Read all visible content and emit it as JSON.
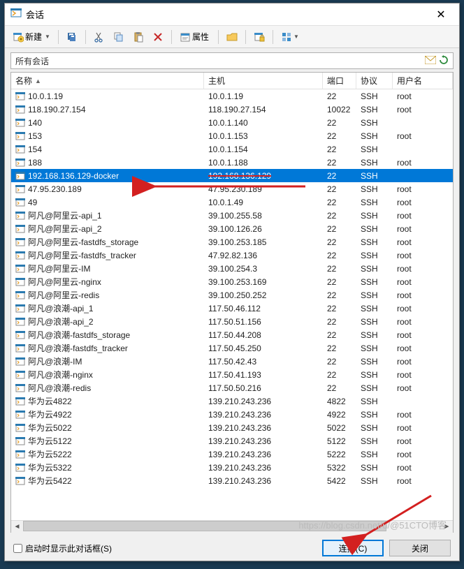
{
  "window": {
    "title": "会话"
  },
  "toolbar": {
    "new_label": "新建",
    "props_label": "属性"
  },
  "filter": {
    "label": "所有会话"
  },
  "columns": {
    "name": "名称",
    "host": "主机",
    "port": "端口",
    "protocol": "协议",
    "user": "用户名"
  },
  "sessions": [
    {
      "name": "10.0.1.19",
      "host": "10.0.1.19",
      "port": "22",
      "proto": "SSH",
      "user": "root"
    },
    {
      "name": "118.190.27.154",
      "host": "118.190.27.154",
      "port": "10022",
      "proto": "SSH",
      "user": "root"
    },
    {
      "name": "140",
      "host": "10.0.1.140",
      "port": "22",
      "proto": "SSH",
      "user": ""
    },
    {
      "name": "153",
      "host": "10.0.1.153",
      "port": "22",
      "proto": "SSH",
      "user": "root"
    },
    {
      "name": "154",
      "host": "10.0.1.154",
      "port": "22",
      "proto": "SSH",
      "user": ""
    },
    {
      "name": "188",
      "host": "10.0.1.188",
      "port": "22",
      "proto": "SSH",
      "user": "root"
    },
    {
      "name": "192.168.136.129-docker",
      "host": "192.168.136.129",
      "port": "22",
      "proto": "SSH",
      "user": "",
      "selected": true
    },
    {
      "name": "47.95.230.189",
      "host": "47.95.230.189",
      "port": "22",
      "proto": "SSH",
      "user": "root"
    },
    {
      "name": "49",
      "host": "10.0.1.49",
      "port": "22",
      "proto": "SSH",
      "user": "root"
    },
    {
      "name": "阿凡@阿里云-api_1",
      "host": "39.100.255.58",
      "port": "22",
      "proto": "SSH",
      "user": "root"
    },
    {
      "name": "阿凡@阿里云-api_2",
      "host": "39.100.126.26",
      "port": "22",
      "proto": "SSH",
      "user": "root"
    },
    {
      "name": "阿凡@阿里云-fastdfs_storage",
      "host": "39.100.253.185",
      "port": "22",
      "proto": "SSH",
      "user": "root"
    },
    {
      "name": "阿凡@阿里云-fastdfs_tracker",
      "host": "47.92.82.136",
      "port": "22",
      "proto": "SSH",
      "user": "root"
    },
    {
      "name": "阿凡@阿里云-IM",
      "host": "39.100.254.3",
      "port": "22",
      "proto": "SSH",
      "user": "root"
    },
    {
      "name": "阿凡@阿里云-nginx",
      "host": "39.100.253.169",
      "port": "22",
      "proto": "SSH",
      "user": "root"
    },
    {
      "name": "阿凡@阿里云-redis",
      "host": "39.100.250.252",
      "port": "22",
      "proto": "SSH",
      "user": "root"
    },
    {
      "name": "阿凡@浪潮-api_1",
      "host": "117.50.46.112",
      "port": "22",
      "proto": "SSH",
      "user": "root"
    },
    {
      "name": "阿凡@浪潮-api_2",
      "host": "117.50.51.156",
      "port": "22",
      "proto": "SSH",
      "user": "root"
    },
    {
      "name": "阿凡@浪潮-fastdfs_storage",
      "host": "117.50.44.208",
      "port": "22",
      "proto": "SSH",
      "user": "root"
    },
    {
      "name": "阿凡@浪潮-fastdfs_tracker",
      "host": "117.50.45.250",
      "port": "22",
      "proto": "SSH",
      "user": "root"
    },
    {
      "name": "阿凡@浪潮-IM",
      "host": "117.50.42.43",
      "port": "22",
      "proto": "SSH",
      "user": "root"
    },
    {
      "name": "阿凡@浪潮-nginx",
      "host": "117.50.41.193",
      "port": "22",
      "proto": "SSH",
      "user": "root"
    },
    {
      "name": "阿凡@浪潮-redis",
      "host": "117.50.50.216",
      "port": "22",
      "proto": "SSH",
      "user": "root"
    },
    {
      "name": "华为云4822",
      "host": "139.210.243.236",
      "port": "4822",
      "proto": "SSH",
      "user": ""
    },
    {
      "name": "华为云4922",
      "host": "139.210.243.236",
      "port": "4922",
      "proto": "SSH",
      "user": "root"
    },
    {
      "name": "华为云5022",
      "host": "139.210.243.236",
      "port": "5022",
      "proto": "SSH",
      "user": "root"
    },
    {
      "name": "华为云5122",
      "host": "139.210.243.236",
      "port": "5122",
      "proto": "SSH",
      "user": "root"
    },
    {
      "name": "华为云5222",
      "host": "139.210.243.236",
      "port": "5222",
      "proto": "SSH",
      "user": "root"
    },
    {
      "name": "华为云5322",
      "host": "139.210.243.236",
      "port": "5322",
      "proto": "SSH",
      "user": "root"
    },
    {
      "name": "华为云5422",
      "host": "139.210.243.236",
      "port": "5422",
      "proto": "SSH",
      "user": "root"
    }
  ],
  "bottom": {
    "checkbox_label": "启动时显示此对话框(S)",
    "connect": "连接(C)",
    "close": "关闭"
  },
  "watermark": "https://blog.csdn.net/u/@51CTO博客"
}
